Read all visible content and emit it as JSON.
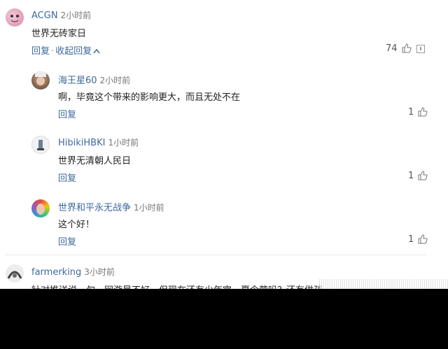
{
  "comments": [
    {
      "user": "ACGN",
      "time": "2小时前",
      "text": "世界无砖家日",
      "reply_label": "回复",
      "collapse_label": "收起回复",
      "likes": "74"
    }
  ],
  "replies": [
    {
      "user": "海王星60",
      "time": "2小时前",
      "text": "啊，毕竟这个带来的影响更大，而且无处不在",
      "reply_label": "回复",
      "likes": "1"
    },
    {
      "user": "HibikiHBKI",
      "time": "1小时前",
      "text": "世界无清朝人民日",
      "reply_label": "回复",
      "likes": "1"
    },
    {
      "user": "世界和平永无战争",
      "time": "1小时前",
      "text": "这个好！",
      "reply_label": "回复",
      "likes": "1"
    }
  ],
  "next_comment": {
    "user": "farmerking",
    "time": "3小时前",
    "text_partial": "针对推送说一句，网游是不好，但现在还有少年宫，夏令营吗？还有供孩"
  },
  "colors": {
    "link": "#3e6a9e",
    "text": "#222222",
    "meta": "#777777"
  },
  "icons": [
    "thumb-up-icon",
    "report-icon",
    "chevron-up-icon"
  ]
}
